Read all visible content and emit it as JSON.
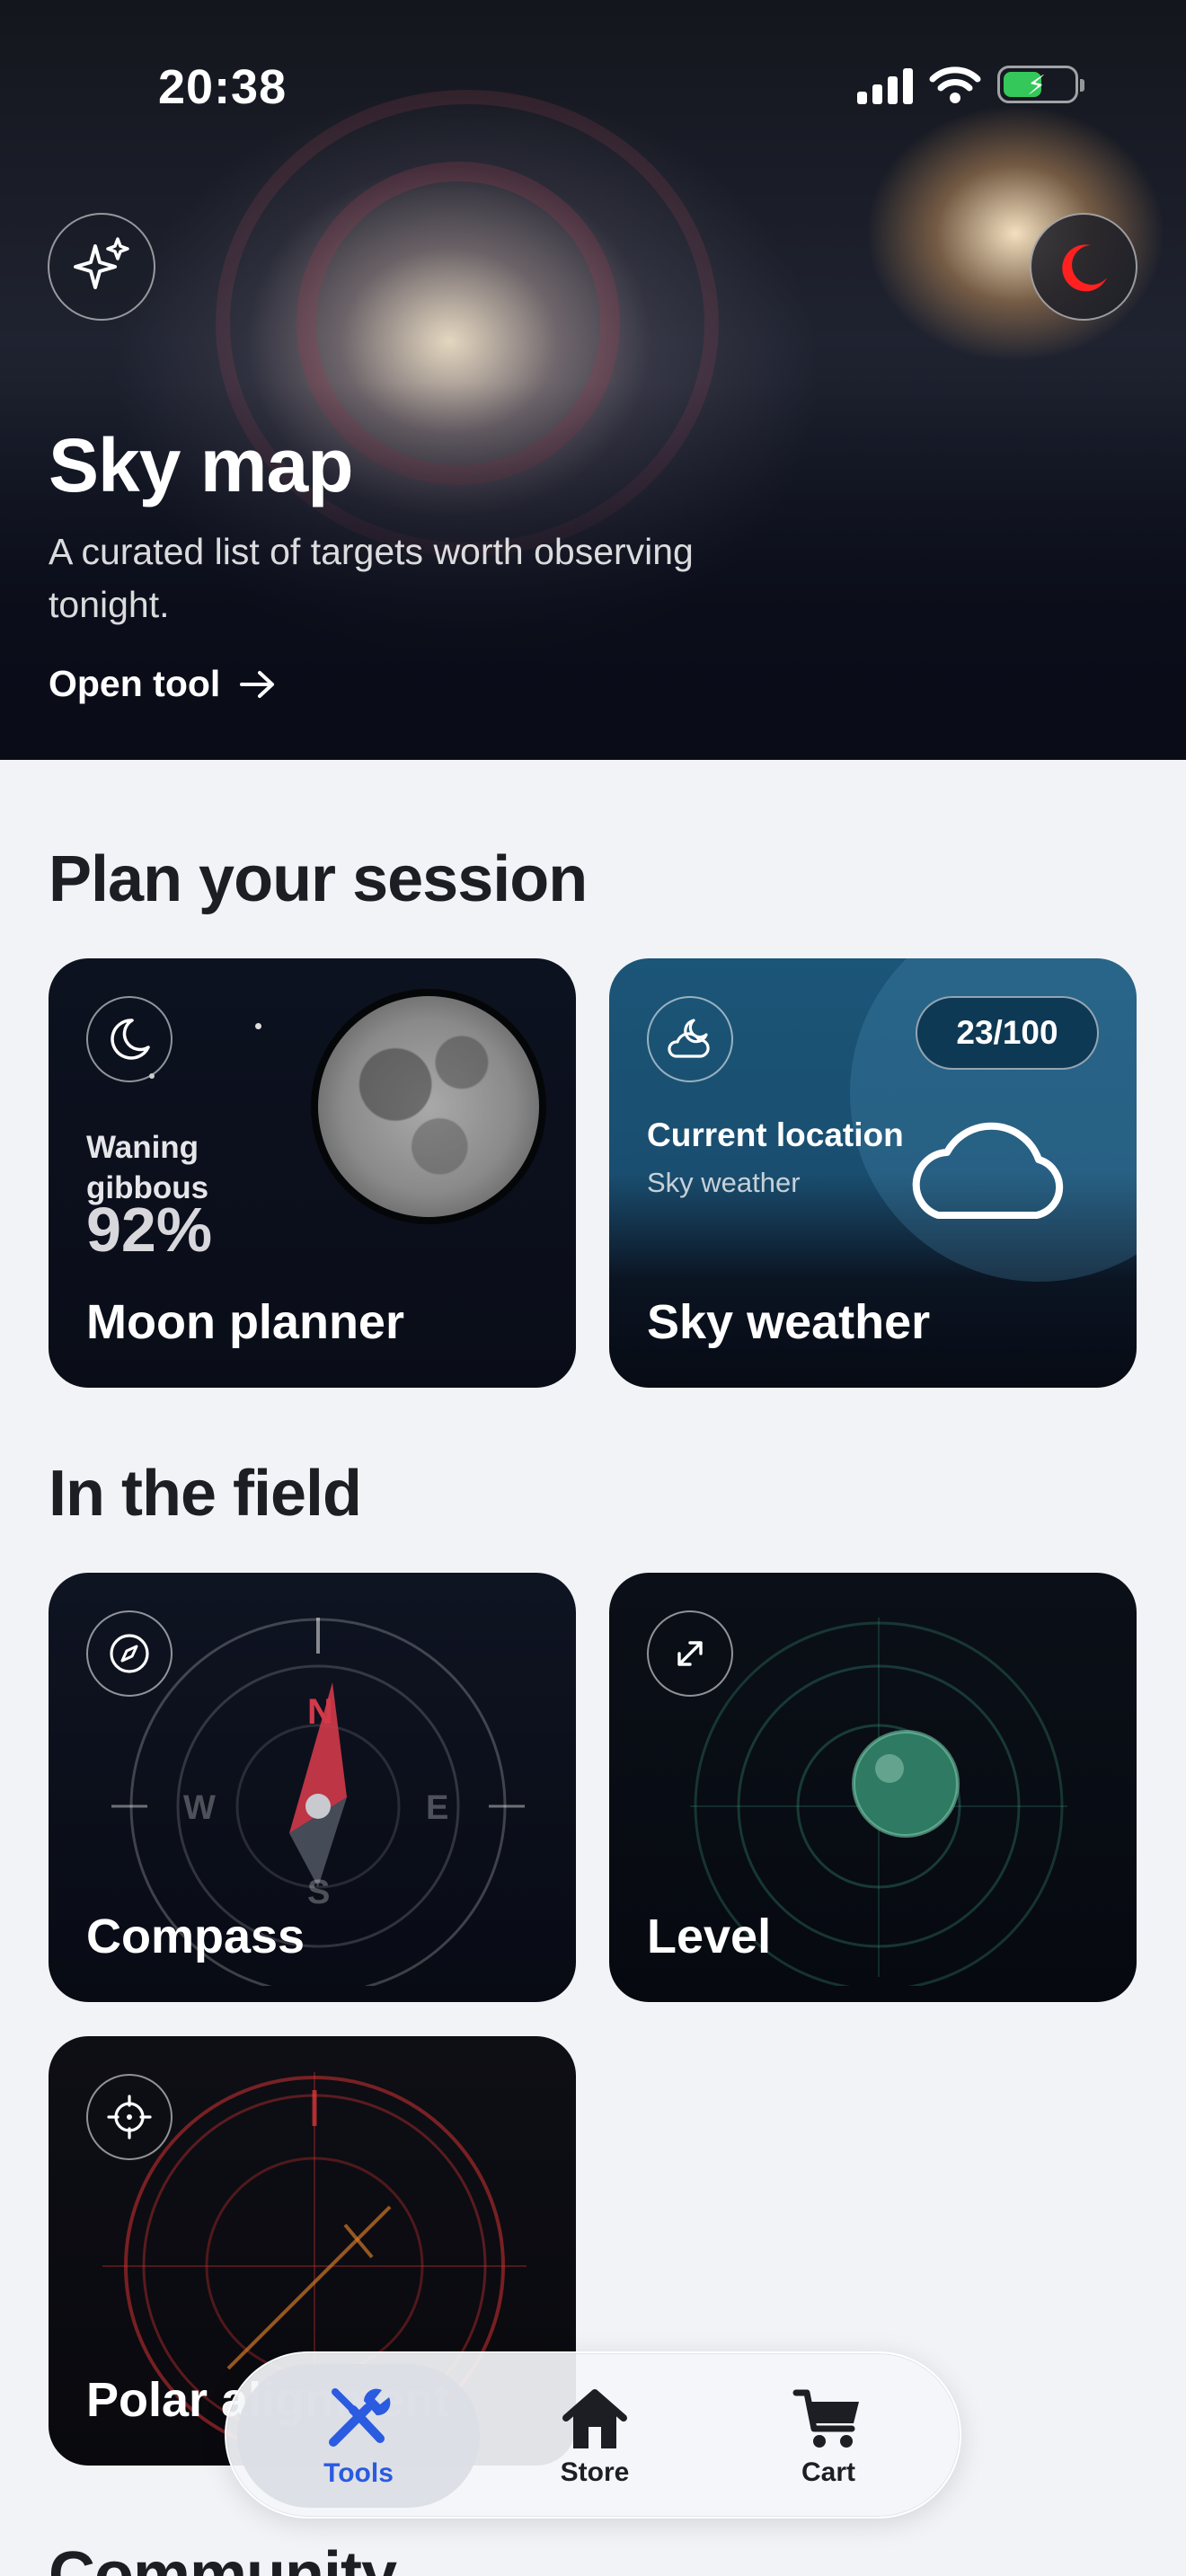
{
  "status": {
    "time": "20:38"
  },
  "hero": {
    "title": "Sky map",
    "description": "A curated list of targets worth observing tonight.",
    "cta": "Open tool"
  },
  "plan": {
    "title": "Plan your session",
    "moon": {
      "phase": "Waning gibbous",
      "illumination": "92%",
      "label": "Moon planner"
    },
    "weather": {
      "score": "23/100",
      "location": "Current location",
      "subtitle": "Sky weather",
      "label": "Sky weather"
    }
  },
  "field": {
    "title": "In the field",
    "compass": {
      "label": "Compass",
      "n": "N",
      "e": "E",
      "s": "S",
      "w": "W"
    },
    "level": {
      "label": "Level"
    },
    "polar": {
      "label": "Polar alignment"
    }
  },
  "community": {
    "title": "Community"
  },
  "tabbar": {
    "tools": "Tools",
    "store": "Store",
    "cart": "Cart"
  },
  "colors": {
    "accent": "#2a5be0",
    "battery": "#34c759",
    "red_mode": "#ff2020"
  }
}
